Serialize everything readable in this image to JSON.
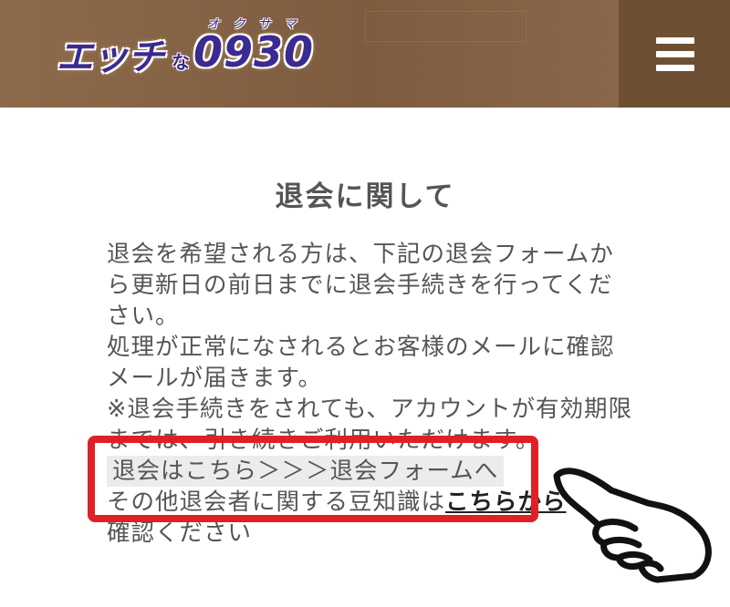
{
  "header": {
    "logo_main": "エッチ",
    "logo_na": "な",
    "logo_num": "0930",
    "logo_ruby": "オクサマ",
    "menu_icon": "hamburger-menu-icon",
    "background": "#8e6a4c",
    "menu_background": "#6f4f33"
  },
  "page": {
    "title": "退会に関して",
    "paragraph1": "退会を希望される方は、下記の退会フォームから更新日の前日までに退会手続きを行ってください。",
    "paragraph2": "処理が正常になされるとお客様のメールに確認メールが届きます。",
    "paragraph3": "※退会手続きをされても、アカウントが有効期限までは、引き続きご利用いただけます。",
    "withdraw_link": "退会はこちら＞＞＞退会フォームへ",
    "info_prefix": "その他退会者に関する豆知識は",
    "info_link": "こちらから",
    "info_suffix": "確認ください"
  },
  "annotation": {
    "highlight_color": "#e02027",
    "pointer_icon": "pointing-hand-icon"
  }
}
